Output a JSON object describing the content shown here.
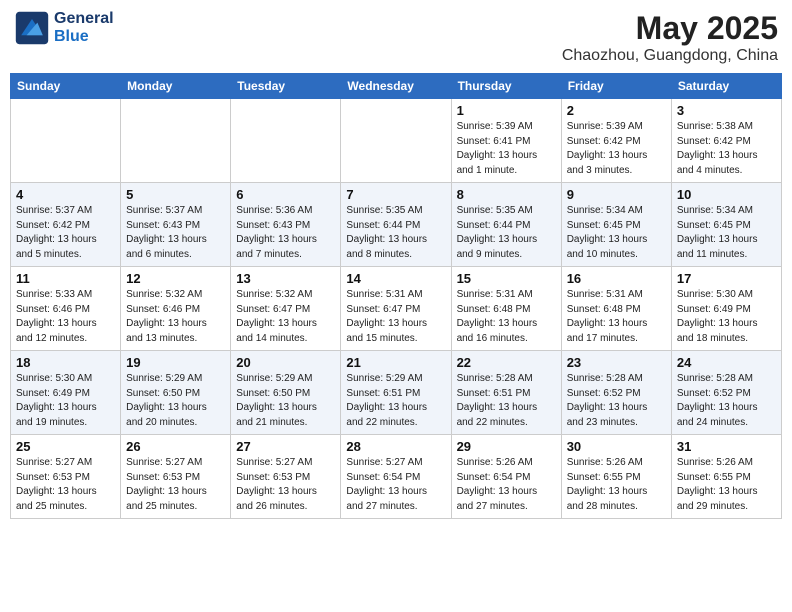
{
  "header": {
    "logo_line1": "General",
    "logo_line2": "Blue",
    "month": "May 2025",
    "location": "Chaozhou, Guangdong, China"
  },
  "weekdays": [
    "Sunday",
    "Monday",
    "Tuesday",
    "Wednesday",
    "Thursday",
    "Friday",
    "Saturday"
  ],
  "weeks": [
    [
      {
        "day": "",
        "info": ""
      },
      {
        "day": "",
        "info": ""
      },
      {
        "day": "",
        "info": ""
      },
      {
        "day": "",
        "info": ""
      },
      {
        "day": "1",
        "info": "Sunrise: 5:39 AM\nSunset: 6:41 PM\nDaylight: 13 hours\nand 1 minute."
      },
      {
        "day": "2",
        "info": "Sunrise: 5:39 AM\nSunset: 6:42 PM\nDaylight: 13 hours\nand 3 minutes."
      },
      {
        "day": "3",
        "info": "Sunrise: 5:38 AM\nSunset: 6:42 PM\nDaylight: 13 hours\nand 4 minutes."
      }
    ],
    [
      {
        "day": "4",
        "info": "Sunrise: 5:37 AM\nSunset: 6:42 PM\nDaylight: 13 hours\nand 5 minutes."
      },
      {
        "day": "5",
        "info": "Sunrise: 5:37 AM\nSunset: 6:43 PM\nDaylight: 13 hours\nand 6 minutes."
      },
      {
        "day": "6",
        "info": "Sunrise: 5:36 AM\nSunset: 6:43 PM\nDaylight: 13 hours\nand 7 minutes."
      },
      {
        "day": "7",
        "info": "Sunrise: 5:35 AM\nSunset: 6:44 PM\nDaylight: 13 hours\nand 8 minutes."
      },
      {
        "day": "8",
        "info": "Sunrise: 5:35 AM\nSunset: 6:44 PM\nDaylight: 13 hours\nand 9 minutes."
      },
      {
        "day": "9",
        "info": "Sunrise: 5:34 AM\nSunset: 6:45 PM\nDaylight: 13 hours\nand 10 minutes."
      },
      {
        "day": "10",
        "info": "Sunrise: 5:34 AM\nSunset: 6:45 PM\nDaylight: 13 hours\nand 11 minutes."
      }
    ],
    [
      {
        "day": "11",
        "info": "Sunrise: 5:33 AM\nSunset: 6:46 PM\nDaylight: 13 hours\nand 12 minutes."
      },
      {
        "day": "12",
        "info": "Sunrise: 5:32 AM\nSunset: 6:46 PM\nDaylight: 13 hours\nand 13 minutes."
      },
      {
        "day": "13",
        "info": "Sunrise: 5:32 AM\nSunset: 6:47 PM\nDaylight: 13 hours\nand 14 minutes."
      },
      {
        "day": "14",
        "info": "Sunrise: 5:31 AM\nSunset: 6:47 PM\nDaylight: 13 hours\nand 15 minutes."
      },
      {
        "day": "15",
        "info": "Sunrise: 5:31 AM\nSunset: 6:48 PM\nDaylight: 13 hours\nand 16 minutes."
      },
      {
        "day": "16",
        "info": "Sunrise: 5:31 AM\nSunset: 6:48 PM\nDaylight: 13 hours\nand 17 minutes."
      },
      {
        "day": "17",
        "info": "Sunrise: 5:30 AM\nSunset: 6:49 PM\nDaylight: 13 hours\nand 18 minutes."
      }
    ],
    [
      {
        "day": "18",
        "info": "Sunrise: 5:30 AM\nSunset: 6:49 PM\nDaylight: 13 hours\nand 19 minutes."
      },
      {
        "day": "19",
        "info": "Sunrise: 5:29 AM\nSunset: 6:50 PM\nDaylight: 13 hours\nand 20 minutes."
      },
      {
        "day": "20",
        "info": "Sunrise: 5:29 AM\nSunset: 6:50 PM\nDaylight: 13 hours\nand 21 minutes."
      },
      {
        "day": "21",
        "info": "Sunrise: 5:29 AM\nSunset: 6:51 PM\nDaylight: 13 hours\nand 22 minutes."
      },
      {
        "day": "22",
        "info": "Sunrise: 5:28 AM\nSunset: 6:51 PM\nDaylight: 13 hours\nand 22 minutes."
      },
      {
        "day": "23",
        "info": "Sunrise: 5:28 AM\nSunset: 6:52 PM\nDaylight: 13 hours\nand 23 minutes."
      },
      {
        "day": "24",
        "info": "Sunrise: 5:28 AM\nSunset: 6:52 PM\nDaylight: 13 hours\nand 24 minutes."
      }
    ],
    [
      {
        "day": "25",
        "info": "Sunrise: 5:27 AM\nSunset: 6:53 PM\nDaylight: 13 hours\nand 25 minutes."
      },
      {
        "day": "26",
        "info": "Sunrise: 5:27 AM\nSunset: 6:53 PM\nDaylight: 13 hours\nand 25 minutes."
      },
      {
        "day": "27",
        "info": "Sunrise: 5:27 AM\nSunset: 6:53 PM\nDaylight: 13 hours\nand 26 minutes."
      },
      {
        "day": "28",
        "info": "Sunrise: 5:27 AM\nSunset: 6:54 PM\nDaylight: 13 hours\nand 27 minutes."
      },
      {
        "day": "29",
        "info": "Sunrise: 5:26 AM\nSunset: 6:54 PM\nDaylight: 13 hours\nand 27 minutes."
      },
      {
        "day": "30",
        "info": "Sunrise: 5:26 AM\nSunset: 6:55 PM\nDaylight: 13 hours\nand 28 minutes."
      },
      {
        "day": "31",
        "info": "Sunrise: 5:26 AM\nSunset: 6:55 PM\nDaylight: 13 hours\nand 29 minutes."
      }
    ]
  ]
}
